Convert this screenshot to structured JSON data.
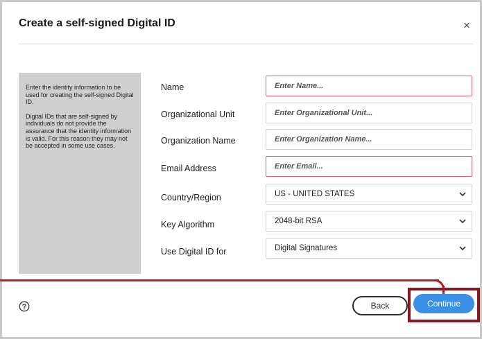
{
  "dialog": {
    "title": "Create a self-signed Digital ID",
    "close_label": "×"
  },
  "info": {
    "paragraph1": "Enter the identity information to be used for creating the self-signed Digital ID.",
    "paragraph2": "Digital IDs that are self-signed by individuals do not provide the assurance that the identity information is valid. For this reason they may not be accepted in some use cases."
  },
  "fields": {
    "name": {
      "label": "Name",
      "placeholder": "Enter Name...",
      "value": ""
    },
    "org_unit": {
      "label": "Organizational Unit",
      "placeholder": "Enter Organizational Unit...",
      "value": ""
    },
    "org_name": {
      "label": "Organization Name",
      "placeholder": "Enter Organization Name...",
      "value": ""
    },
    "email": {
      "label": "Email Address",
      "placeholder": "Enter Email...",
      "value": ""
    },
    "country": {
      "label": "Country/Region",
      "selected": "US - UNITED STATES"
    },
    "key_algorithm": {
      "label": "Key Algorithm",
      "selected": "2048-bit RSA"
    },
    "use_for": {
      "label": "Use Digital ID for",
      "selected": "Digital Signatures"
    }
  },
  "footer": {
    "help_icon": "question-circle-icon",
    "back_label": "Back",
    "continue_label": "Continue"
  },
  "colors": {
    "required_border": "#d95c62",
    "primary_button": "#3b8fe4",
    "annotation": "#b01e2e"
  }
}
